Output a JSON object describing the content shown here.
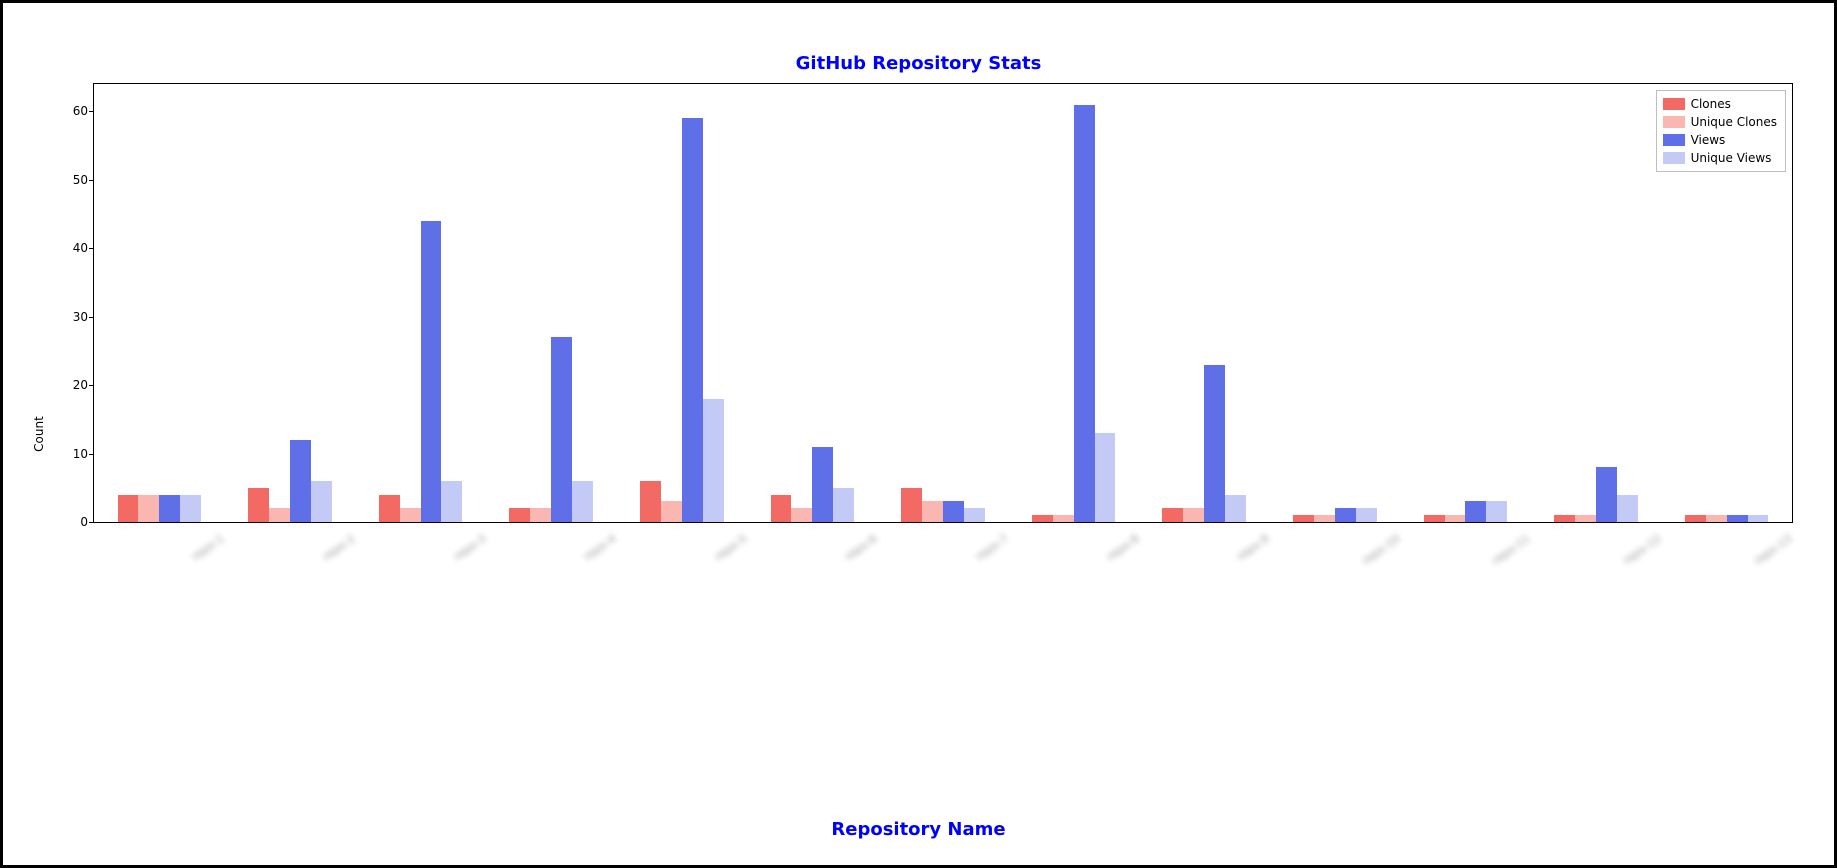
{
  "chart_data": {
    "type": "bar",
    "title": "GitHub Repository Stats",
    "xlabel": "Repository Name",
    "ylabel": "Count",
    "ylim": [
      0,
      64
    ],
    "yticks": [
      0,
      10,
      20,
      30,
      40,
      50,
      60
    ],
    "categories": [
      "repo-1",
      "repo-2",
      "repo-3",
      "repo-4",
      "repo-5",
      "repo-6",
      "repo-7",
      "repo-8",
      "repo-9",
      "repo-10",
      "repo-11",
      "repo-12",
      "repo-13"
    ],
    "series": [
      {
        "name": "Clones",
        "color": "#f26a63",
        "values": [
          4,
          5,
          4,
          2,
          6,
          4,
          5,
          1,
          2,
          1,
          1,
          1,
          1
        ]
      },
      {
        "name": "Unique Clones",
        "color": "#fab7b2",
        "values": [
          4,
          2,
          2,
          2,
          3,
          2,
          3,
          1,
          2,
          1,
          1,
          1,
          1
        ]
      },
      {
        "name": "Views",
        "color": "#5f6fe8",
        "values": [
          4,
          12,
          44,
          27,
          59,
          11,
          3,
          61,
          23,
          2,
          3,
          8,
          1
        ]
      },
      {
        "name": "Unique Views",
        "color": "#c3caf6",
        "values": [
          4,
          6,
          6,
          6,
          18,
          5,
          2,
          13,
          4,
          2,
          3,
          4,
          1
        ]
      }
    ],
    "legend_position": "top-right",
    "grid": false
  }
}
